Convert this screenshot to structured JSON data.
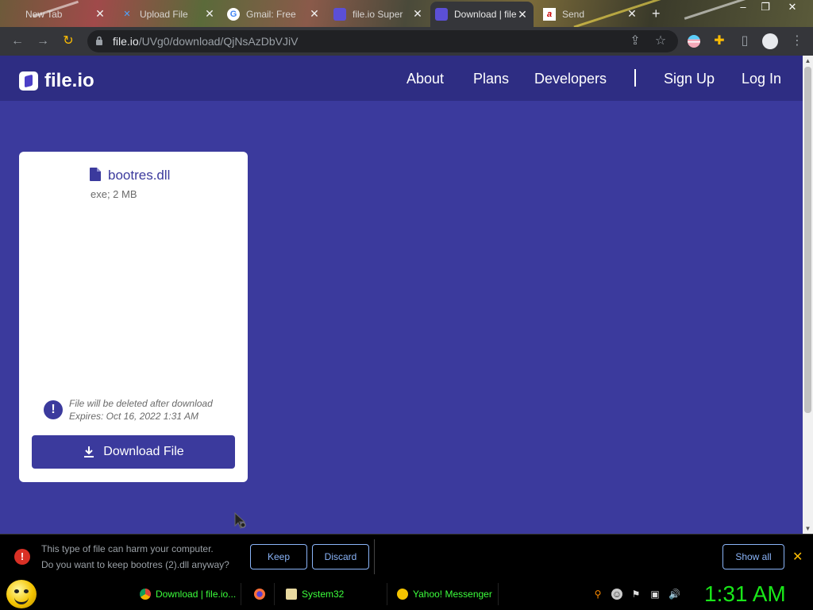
{
  "browser": {
    "tabs": [
      {
        "title": "New Tab",
        "icon": "newtab-icon"
      },
      {
        "title": "Upload File",
        "icon": "upload-icon"
      },
      {
        "title": "Gmail: Free",
        "icon": "google-icon"
      },
      {
        "title": "file.io Super",
        "icon": "fileio-icon"
      },
      {
        "title": "Download | file.io",
        "icon": "fileio-icon"
      },
      {
        "title": "Send",
        "icon": "a-icon"
      }
    ],
    "new_tab_label": "+",
    "address": {
      "host": "file.io",
      "path": "/UVg0/download/QjNsAzDbVJiV"
    }
  },
  "site": {
    "brand": "file.io",
    "nav": {
      "about": "About",
      "plans": "Plans",
      "developers": "Developers",
      "signup": "Sign Up",
      "login": "Log In"
    },
    "file": {
      "name": "bootres.dll",
      "meta": "exe; 2 MB",
      "notice_line1": "File will be deleted after download",
      "notice_line2": "Expires: Oct 16, 2022 1:31 AM",
      "download_label": "Download File"
    }
  },
  "download_shelf": {
    "warning_line1": "This type of file can harm your computer.",
    "warning_line2": "Do you want to keep bootres (2).dll anyway?",
    "keep_label": "Keep",
    "discard_label": "Discard",
    "show_all_label": "Show all"
  },
  "taskbar": {
    "items": [
      {
        "label": "Download | file.io..."
      },
      {
        "label": "System32"
      },
      {
        "label": "Yahoo! Messenger"
      }
    ],
    "clock": "1:31 AM"
  },
  "colors": {
    "page_bg": "#3b3a9d",
    "nav_bg": "#2e2d83",
    "accent": "#3b3a9d",
    "clock": "#19e619"
  }
}
